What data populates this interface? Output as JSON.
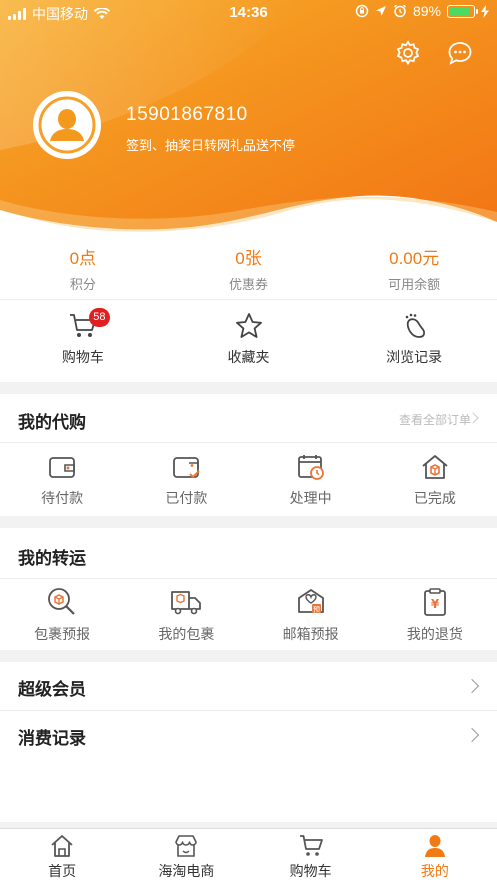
{
  "status_bar": {
    "carrier": "中国移动",
    "time": "14:36",
    "battery": "89%",
    "battery_level": 0.89
  },
  "profile": {
    "phone": "15901867810",
    "slogan": "签到、抽奖日转网礼品送不停"
  },
  "stats": [
    {
      "value": "0点",
      "label": "积分"
    },
    {
      "value": "0张",
      "label": "优惠券"
    },
    {
      "value": "0.00元",
      "label": "可用余额"
    }
  ],
  "quick": {
    "cart": {
      "label": "购物车",
      "badge": "58"
    },
    "favorites": {
      "label": "收藏夹"
    },
    "history": {
      "label": "浏览记录"
    }
  },
  "purchase": {
    "title": "我的代购",
    "more": "查看全部订单",
    "items": [
      {
        "label": "待付款",
        "icon": "wallet-icon"
      },
      {
        "label": "已付款",
        "icon": "wallet-check-icon"
      },
      {
        "label": "处理中",
        "icon": "calendar-clock-icon"
      },
      {
        "label": "已完成",
        "icon": "house-box-icon"
      }
    ]
  },
  "transfer": {
    "title": "我的转运",
    "items": [
      {
        "label": "包裹预报",
        "icon": "package-search-icon"
      },
      {
        "label": "我的包裹",
        "icon": "delivery-truck-icon"
      },
      {
        "label": "邮箱预报",
        "icon": "mailbox-icon"
      },
      {
        "label": "我的退货",
        "icon": "return-clipboard-icon"
      }
    ]
  },
  "menu_rows": {
    "vip": "超级会员",
    "spending": "消费记录"
  },
  "tabbar": {
    "tabs": [
      {
        "label": "首页",
        "icon": "home-icon"
      },
      {
        "label": "海淘电商",
        "icon": "shop-icon"
      },
      {
        "label": "购物车",
        "icon": "cart-icon"
      },
      {
        "label": "我的",
        "icon": "person-icon",
        "active": true
      }
    ]
  },
  "colors": {
    "accent": "#f07a14",
    "header_gradient_start": "#f6a623",
    "header_gradient_end": "#f27b16",
    "badge": "#e02020",
    "icon_accent": "#e8763a"
  }
}
